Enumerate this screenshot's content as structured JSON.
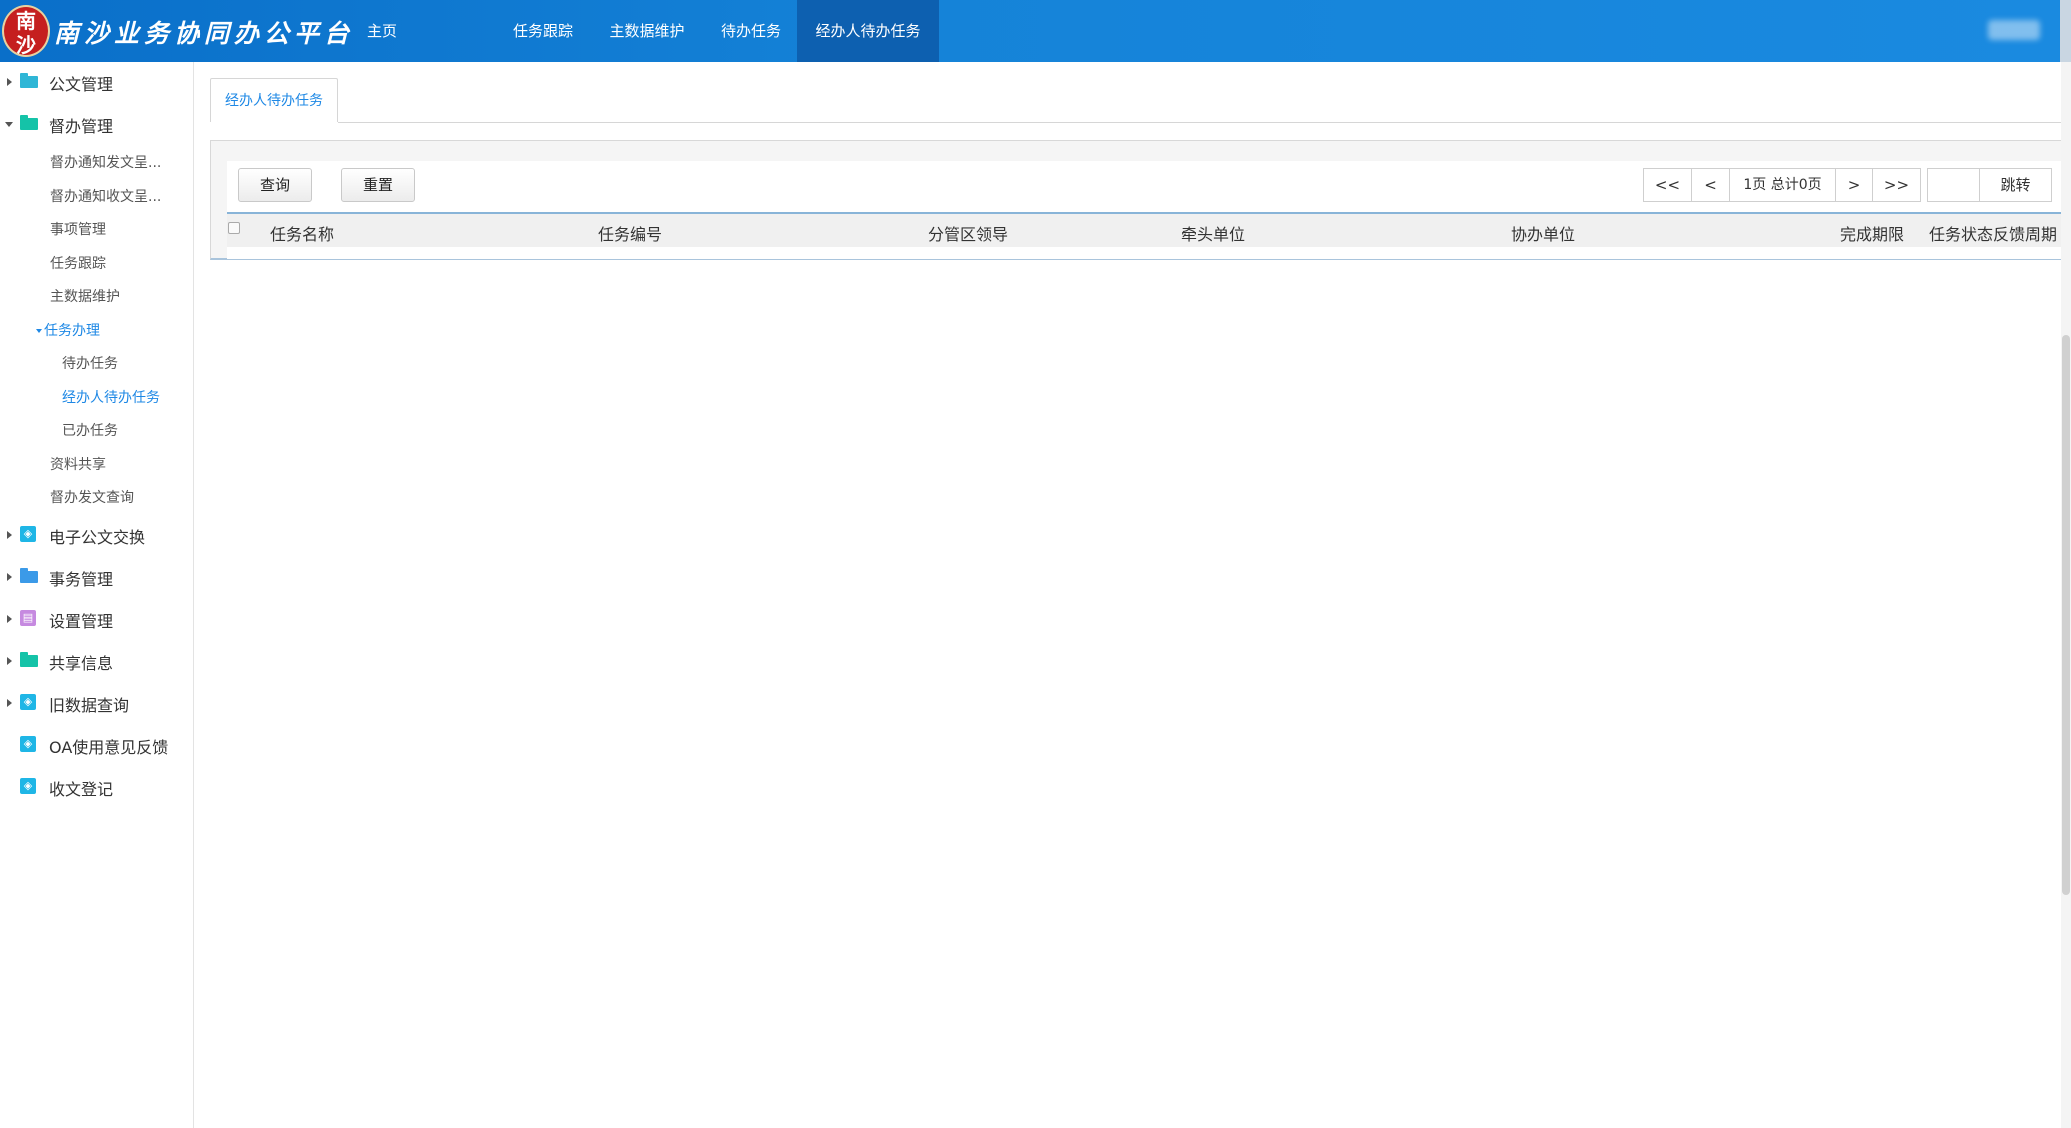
{
  "header": {
    "logo_text": "南沙",
    "title": "南沙业务协同办公平台",
    "nav": [
      {
        "label": "主页"
      },
      {
        "label": "任务跟踪"
      },
      {
        "label": "主数据维护"
      },
      {
        "label": "待办任务"
      },
      {
        "label": "经办人待办任务"
      }
    ],
    "active_nav": "经办人待办任务"
  },
  "sidebar": {
    "groups": [
      {
        "label": "公文管理",
        "icon": "folder-cloud-icon",
        "expanded": false
      },
      {
        "label": "督办管理",
        "icon": "folder-icon",
        "expanded": true
      },
      {
        "label": "电子公文交换",
        "icon": "box-icon",
        "expanded": false
      },
      {
        "label": "事务管理",
        "icon": "folder-icon",
        "expanded": false
      },
      {
        "label": "设置管理",
        "icon": "settings-box-icon",
        "expanded": false
      },
      {
        "label": "共享信息",
        "icon": "folder-icon",
        "expanded": false
      },
      {
        "label": "旧数据查询",
        "icon": "box-icon",
        "expanded": false
      },
      {
        "label": "OA使用意见反馈",
        "icon": "box-icon",
        "expanded": false
      },
      {
        "label": "收文登记",
        "icon": "box-icon",
        "expanded": false
      }
    ],
    "sub_items": [
      {
        "label": "督办通知发文呈..."
      },
      {
        "label": "督办通知收文呈..."
      },
      {
        "label": "事项管理"
      },
      {
        "label": "任务跟踪"
      },
      {
        "label": "主数据维护"
      },
      {
        "label": "任务办理"
      },
      {
        "label": "待办任务"
      },
      {
        "label": "经办人待办任务"
      },
      {
        "label": "已办任务"
      },
      {
        "label": "资料共享"
      },
      {
        "label": "督办发文查询"
      }
    ]
  },
  "main": {
    "tab_label": "经办人待办任务",
    "buttons": {
      "query": "查询",
      "reset": "重置"
    },
    "pager": {
      "first": "<<",
      "prev": "<",
      "info": "1页 总计0页",
      "next": ">",
      "last": ">>",
      "jump_value": "",
      "jump": "跳转"
    },
    "columns": [
      "任务名称",
      "任务编号",
      "分管区领导",
      "牵头单位",
      "协办单位",
      "完成期限",
      "任务状态反馈周期"
    ],
    "rows": []
  },
  "colors": {
    "header_blue": "#1583d8",
    "active_nav": "#0d60b0",
    "link_blue": "#1e88e5",
    "folder_teal": "#15c3a8",
    "folder_blue": "#3b9ae8",
    "box_cyan": "#1fb6e6",
    "settings_purple": "#c68ae0"
  }
}
